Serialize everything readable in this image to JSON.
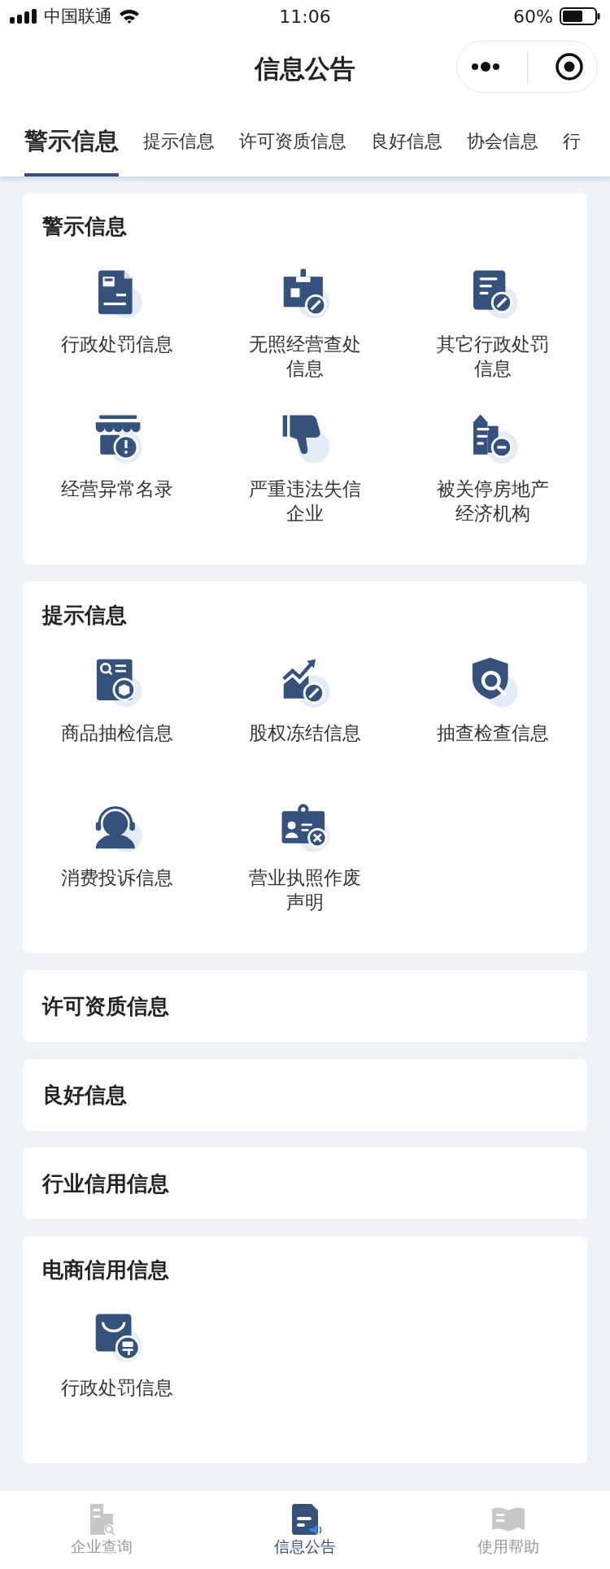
{
  "status_bar": {
    "carrier": "中国联通",
    "time": "11:06",
    "battery": "60%"
  },
  "nav": {
    "title": "信息公告"
  },
  "tabs": [
    {
      "label": "警示信息",
      "selected": true
    },
    {
      "label": "提示信息",
      "selected": false
    },
    {
      "label": "许可资质信息",
      "selected": false
    },
    {
      "label": "良好信息",
      "selected": false
    },
    {
      "label": "协会信息",
      "selected": false
    },
    {
      "label": "行",
      "selected": false
    }
  ],
  "sections": [
    {
      "title": "警示信息",
      "items": [
        {
          "label": "行政处罚信息"
        },
        {
          "label": "无照经营查处信息"
        },
        {
          "label": "其它行政处罚信息"
        },
        {
          "label": "经营异常名录"
        },
        {
          "label": "严重违法失信企业"
        },
        {
          "label": "被关停房地产经济机构"
        }
      ]
    },
    {
      "title": "提示信息",
      "items": [
        {
          "label": "商品抽检信息"
        },
        {
          "label": "股权冻结信息"
        },
        {
          "label": "抽查检查信息"
        },
        {
          "label": "消费投诉信息"
        },
        {
          "label": "营业执照作废声明"
        }
      ]
    },
    {
      "title": "许可资质信息"
    },
    {
      "title": "良好信息"
    },
    {
      "title": "行业信用信息"
    },
    {
      "title": "电商信用信息",
      "items": [
        {
          "label": "行政处罚信息"
        }
      ]
    }
  ],
  "bottom_nav": [
    {
      "label": "企业查询",
      "selected": false
    },
    {
      "label": "信息公告",
      "selected": true
    },
    {
      "label": "使用帮助",
      "selected": false
    }
  ]
}
